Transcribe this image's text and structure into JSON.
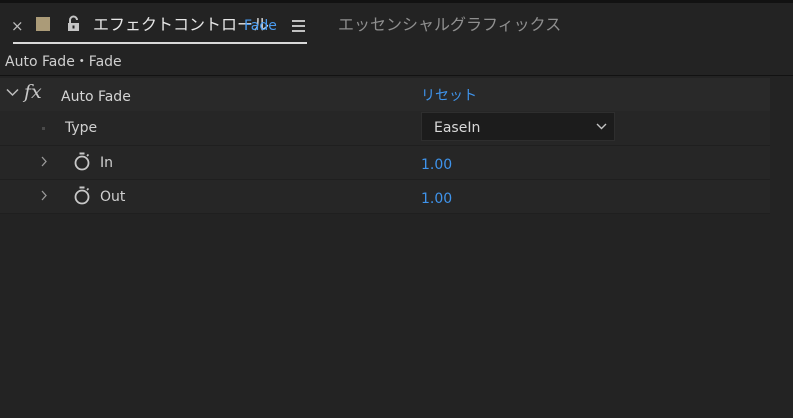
{
  "tabs": {
    "close_glyph": "×",
    "active_title": "エフェクトコントロール",
    "active_subtitle": "Fade",
    "inactive_title": "エッセンシャルグラフィックス",
    "swatch_color": "#ab9b78",
    "accent_color": "#4a9bf0"
  },
  "breadcrumb": "Auto Fade・Fade",
  "effect": {
    "fx_label": "fx",
    "name": "Auto Fade",
    "reset_label": "リセット"
  },
  "properties": {
    "type": {
      "label": "Type",
      "selected": "EaseIn"
    },
    "in": {
      "label": "In",
      "value": "1.00"
    },
    "out": {
      "label": "Out",
      "value": "1.00"
    }
  },
  "icons": {
    "close": "close-icon",
    "lock": "lock-icon",
    "menu": "panel-menu-icon",
    "collapse": "chevron-down-icon",
    "expand": "chevron-right-icon",
    "stopwatch": "stopwatch-icon",
    "fx": "fx-icon",
    "dropdown": "chevron-down-icon"
  }
}
